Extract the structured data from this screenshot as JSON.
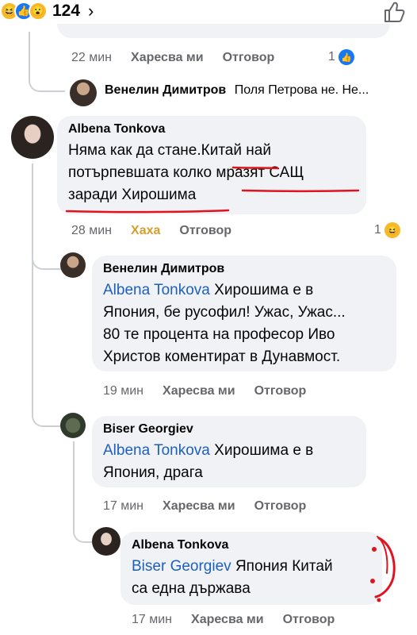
{
  "top_bar": {
    "reaction_count": "124",
    "chevron": "›",
    "reaction_icons": [
      "haha-icon",
      "like-icon",
      "wow-icon"
    ],
    "like_button_icon": "thumbs-up-outline-icon"
  },
  "first_comment": {
    "time": "22 мин",
    "like_label": "Харесва ми",
    "reply_label": "Отговор",
    "reaction_count": "1"
  },
  "collapsed_reply": {
    "author": "Венелин Димитров",
    "preview": "Поля Петрова не. Не..."
  },
  "comments": [
    {
      "author": "Albena Tonkova",
      "text": "Няма как да стане.Китай най потърпевшата колко мразят САЩ заради Хирошима",
      "line1": "Няма как да стане.Китай най",
      "line2": "потърпевшата колко мразят САЩ",
      "line3": "заради Хирошима",
      "time": "28 мин",
      "like_label": "Хаха",
      "reply_label": "Отговор",
      "reaction_count": "1"
    },
    {
      "author": "Венелин Димитров",
      "mention": "Albena Tonkova",
      "line1_rest": " Хирошима е в",
      "line2": "Япония, бе русофил!  Ужас, Ужас...",
      "line3": "80 те процента на професор Иво",
      "line4": "Христов коментират в Дунавмост.",
      "time": "19 мин",
      "like_label": "Харесва ми",
      "reply_label": "Отговор"
    },
    {
      "author": "Biser Georgiev",
      "mention": "Albena Tonkova",
      "line1_rest": " Хирошима е в",
      "line2": "Япония, драга",
      "time": "17 мин",
      "like_label": "Харесва ми",
      "reply_label": "Отговор"
    },
    {
      "author": "Albena Tonkova",
      "mention": "Biser Georgiev",
      "line1_rest": " Япония Китай",
      "line2": "са една  държава",
      "time": "17 мин",
      "like_label": "Харесва ми",
      "reply_label": "Отговор"
    }
  ],
  "colors": {
    "mention": "#1d5fbf",
    "meta_gray": "#65676b",
    "bubble_bg": "#f0f2f5",
    "haha_gold": "#d89e2a",
    "annotation_red": "#e0141e"
  }
}
